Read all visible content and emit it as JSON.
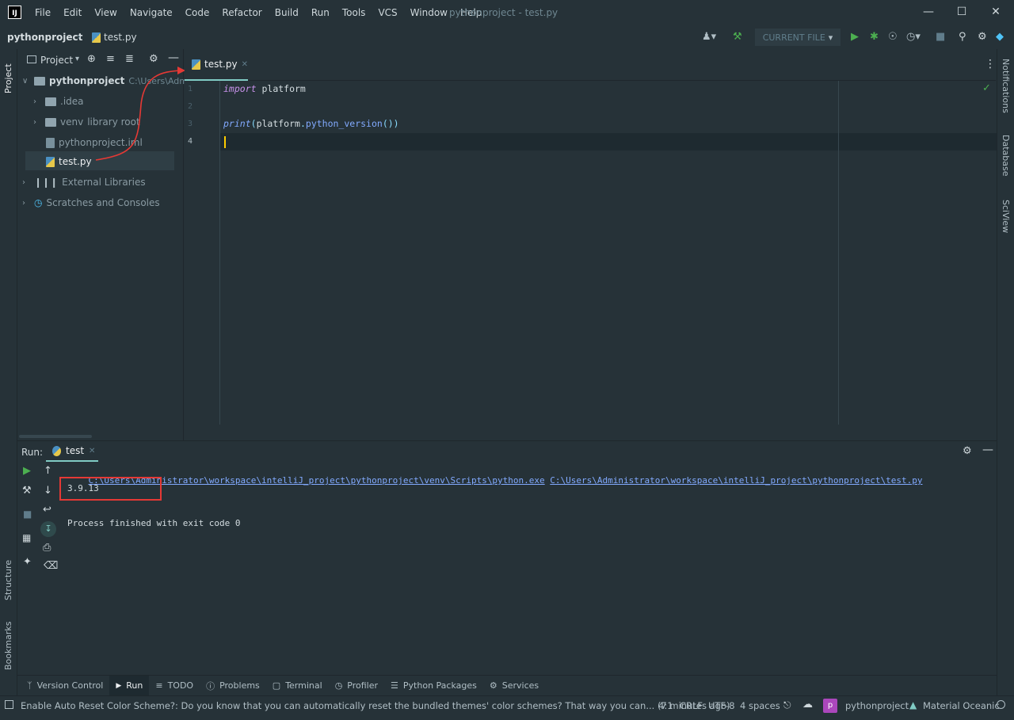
{
  "app": {
    "logo_text": "IJ",
    "window_title": "pythonproject - test.py",
    "window_controls": [
      "minimize-icon",
      "maximize-icon",
      "close-icon"
    ]
  },
  "menu": [
    "File",
    "Edit",
    "View",
    "Navigate",
    "Code",
    "Refactor",
    "Build",
    "Run",
    "Tools",
    "VCS",
    "Window",
    "Help"
  ],
  "navbar": {
    "project": "pythonproject",
    "file": "test.py",
    "run_config": "CURRENT FILE"
  },
  "left_stripe": {
    "project": "Project",
    "structure": "Structure",
    "bookmarks": "Bookmarks"
  },
  "right_stripe": {
    "notifications": "Notifications",
    "database": "Database",
    "sciview": "SciView"
  },
  "project_panel": {
    "title": "Project",
    "root_name": "pythonproject",
    "root_path": "C:\\Users\\Administrator\\workspace\\intelliJ_project\\pythonproject",
    "items": [
      {
        "label": ".idea"
      },
      {
        "label": "venv",
        "suffix": "library root"
      },
      {
        "label": "pythonproject.iml"
      },
      {
        "label": "test.py"
      },
      {
        "label": "External Libraries"
      },
      {
        "label": "Scratches and Consoles"
      }
    ]
  },
  "editor": {
    "tab_label": "test.py",
    "line_numbers": [
      "1",
      "2",
      "3",
      "4"
    ],
    "code": {
      "l1_kw": "import",
      "l1_rest": " platform",
      "l3_fn": "print",
      "l3_p1": "(",
      "l3_obj": "platform",
      "l3_dot": ".",
      "l3_call": "python_version",
      "l3_end": "())"
    }
  },
  "run_panel": {
    "label": "Run:",
    "tab": "test",
    "cmd_exe": "C:\\Users\\Administrator\\workspace\\intelliJ_project\\pythonproject\\venv\\Scripts\\python.exe",
    "cmd_script": "C:\\Users\\Administrator\\workspace\\intelliJ_project\\pythonproject\\test.py",
    "output": "3.9.13",
    "exit_message": "Process finished with exit code 0"
  },
  "tool_tabs": [
    "Version Control",
    "Run",
    "TODO",
    "Problems",
    "Terminal",
    "Profiler",
    "Python Packages",
    "Services"
  ],
  "status": {
    "message": "Enable Auto Reset Color Scheme?: Do you know that you can automatically reset the bundled themes' color schemes? That way you can... (7 minutes ago)",
    "position": "4:1",
    "line_sep": "CRLF",
    "encoding": "UTF-8",
    "indent": "4 spaces",
    "project_badge": "p",
    "project": "pythonproject",
    "theme": "Material Oceanic"
  },
  "colors": {
    "background": "#263238",
    "accent": "#80cbc4",
    "keyword": "#c792ea",
    "function": "#82aaff",
    "link": "#82aaff",
    "highlight_box": "#e53935",
    "run_green": "#4caf50"
  }
}
